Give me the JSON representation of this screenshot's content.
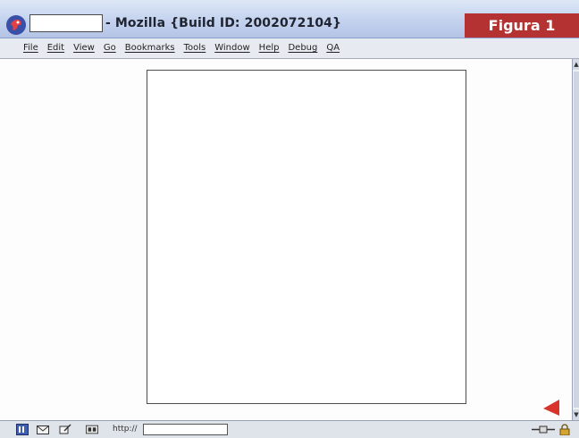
{
  "window": {
    "title": "- Mozilla {Build ID: 2002072104}",
    "badge": "Figura 1"
  },
  "menubar": {
    "items": [
      "File",
      "Edit",
      "View",
      "Go",
      "Bookmarks",
      "Tools",
      "Window",
      "Help",
      "Debug",
      "QA"
    ]
  },
  "statusbar": {
    "url_label": "http://"
  },
  "colors": {
    "titlebar": "#c3d2ee",
    "badge": "#b53232",
    "arrow": "#d8342c"
  },
  "icons": [
    "mozilla-logo-icon",
    "navigator-icon",
    "mail-icon",
    "composer-icon",
    "address-book-icon",
    "online-plug-icon",
    "security-lock-icon",
    "red-corner-arrow-icon"
  ]
}
